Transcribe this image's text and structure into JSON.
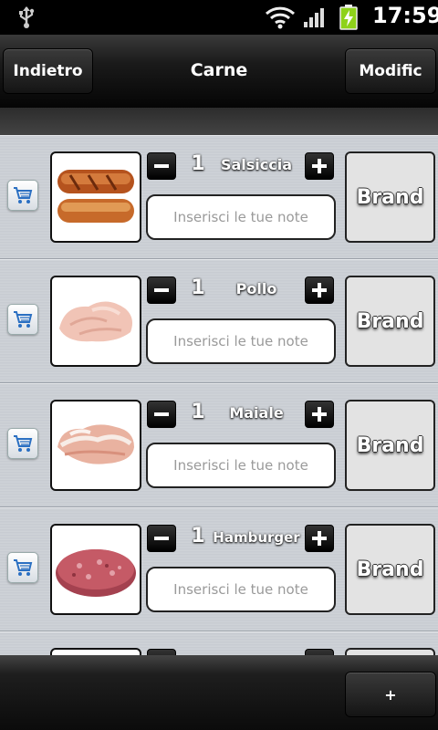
{
  "status_bar": {
    "time": "17:59",
    "icons": [
      "usb-icon",
      "wifi-icon",
      "signal-icon",
      "battery-charging-icon"
    ]
  },
  "header": {
    "back_label": "Indietro",
    "title": "Carne",
    "edit_label": "Modific"
  },
  "items": [
    {
      "qty": "1",
      "name": "Salsiccia",
      "notes_placeholder": "Inserisci le tue note",
      "brand_label": "Brand",
      "image": "sausage"
    },
    {
      "qty": "1",
      "name": "Pollo",
      "notes_placeholder": "Inserisci le tue note",
      "brand_label": "Brand",
      "image": "chicken"
    },
    {
      "qty": "1",
      "name": "Maiale",
      "notes_placeholder": "Inserisci le tue note",
      "brand_label": "Brand",
      "image": "pork"
    },
    {
      "qty": "1",
      "name": "Hamburger",
      "notes_placeholder": "Inserisci le tue note",
      "brand_label": "Brand",
      "image": "hamburger"
    }
  ],
  "footer": {
    "add_label": "+"
  },
  "colors": {
    "list_bg": "#cdd1d6",
    "bar_dark": "#111111",
    "brand_bg": "#e3e3e3"
  }
}
